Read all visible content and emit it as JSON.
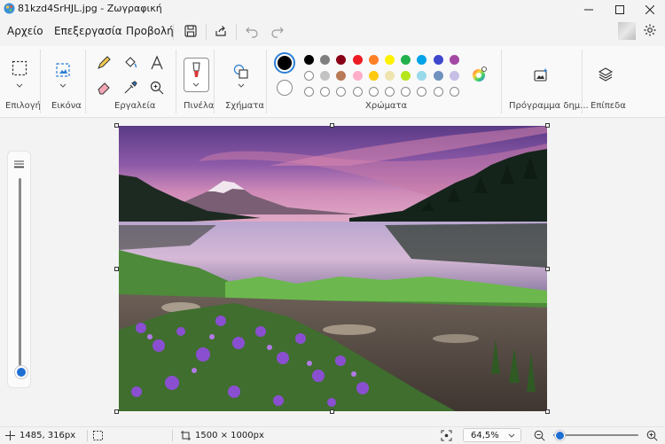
{
  "window": {
    "title": "81kzd4SrHJL.jpg - Ζωγραφική",
    "controls": [
      "minimize",
      "maximize",
      "close"
    ]
  },
  "menu": {
    "items": [
      "Αρχείο",
      "Επεξεργασία",
      "Προβολή"
    ],
    "quick_actions": [
      "save-icon",
      "share-icon",
      "undo-icon",
      "redo-icon"
    ]
  },
  "ribbon": {
    "groups": {
      "selection": "Επιλογή",
      "image": "Εικόνα",
      "tools": "Εργαλεία",
      "brushes": "Πινέλα",
      "shapes": "Σχήματα",
      "colors": "Χρώματα",
      "generator": "Πρόγραμμα δημ...",
      "layers": "Επίπεδα"
    },
    "palette": [
      "#000000",
      "#7f7f7f",
      "#880015",
      "#ed1c24",
      "#ff7f27",
      "#fff200",
      "#22b14c",
      "#00a2e8",
      "#3f48cc",
      "#a349a4",
      "#ffffff",
      "#c3c3c3",
      "#b97a57",
      "#ffaec9",
      "#ffc90e",
      "#efe4b0",
      "#b5e61d",
      "#99d9ea",
      "#7092be",
      "#c8bfe7"
    ],
    "primary_color": "#000000",
    "secondary_color": "#ffffff"
  },
  "status": {
    "cursor_position": "1485, 316px",
    "image_size": "1500 × 1000px",
    "zoom": "64,5%",
    "zoom_fraction": 0.645
  }
}
